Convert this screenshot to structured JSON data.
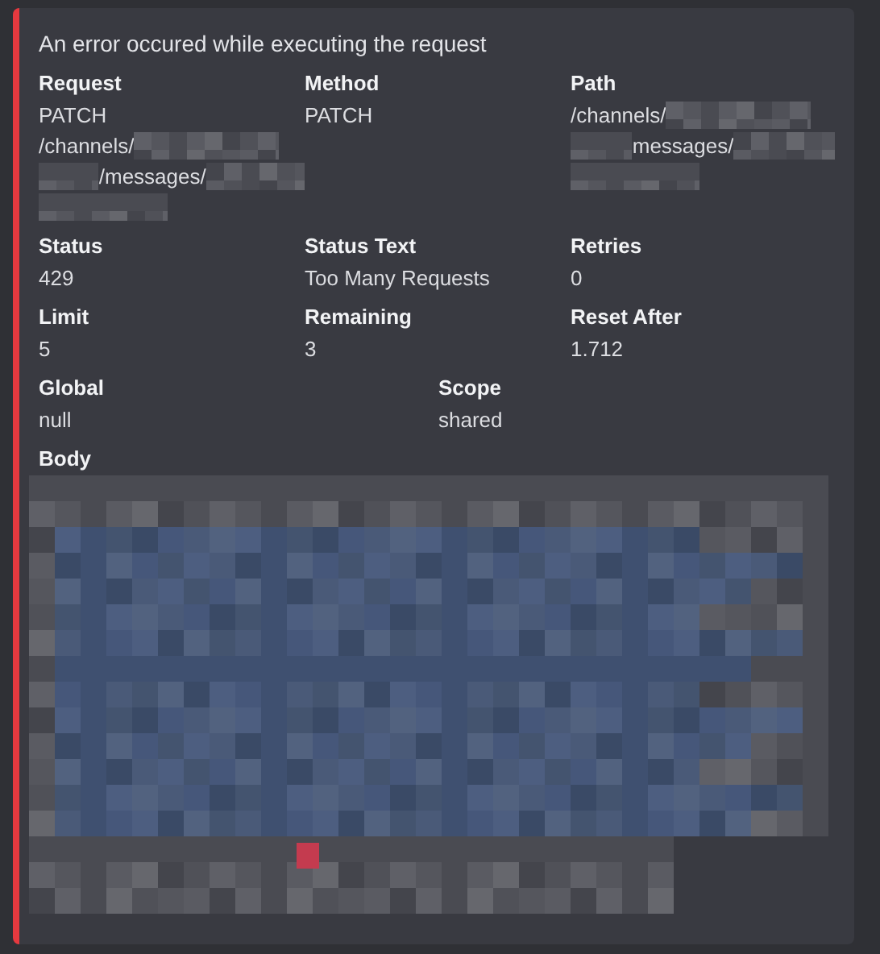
{
  "embed": {
    "title": "An error occured while executing the request",
    "rows": [
      {
        "fields": [
          {
            "name": "Request",
            "lines": [
              [
                {
                  "kind": "text",
                  "text": "PATCH"
                }
              ],
              [
                {
                  "kind": "text",
                  "text": "/channels/"
                },
                {
                  "kind": "redacted"
                }
              ],
              [
                {
                  "kind": "redacted"
                },
                {
                  "kind": "text",
                  "text": "/messages/"
                },
                {
                  "kind": "redacted"
                }
              ],
              [
                {
                  "kind": "redacted"
                }
              ]
            ]
          },
          {
            "name": "Method",
            "lines": [
              [
                {
                  "kind": "text",
                  "text": "PATCH"
                }
              ]
            ]
          },
          {
            "name": "Path",
            "lines": [
              [
                {
                  "kind": "text",
                  "text": "/channels/"
                },
                {
                  "kind": "redacted"
                }
              ],
              [
                {
                  "kind": "redacted"
                },
                {
                  "kind": "text",
                  "text": "messages/"
                },
                {
                  "kind": "redacted"
                }
              ],
              [
                {
                  "kind": "redacted"
                }
              ]
            ]
          }
        ]
      },
      {
        "fields": [
          {
            "name": "Status",
            "lines": [
              [
                {
                  "kind": "text",
                  "text": "429"
                }
              ]
            ]
          },
          {
            "name": "Status Text",
            "lines": [
              [
                {
                  "kind": "text",
                  "text": "Too Many Requests"
                }
              ]
            ]
          },
          {
            "name": "Retries",
            "lines": [
              [
                {
                  "kind": "text",
                  "text": "0"
                }
              ]
            ]
          }
        ]
      },
      {
        "fields": [
          {
            "name": "Limit",
            "lines": [
              [
                {
                  "kind": "text",
                  "text": "5"
                }
              ]
            ]
          },
          {
            "name": "Remaining",
            "lines": [
              [
                {
                  "kind": "text",
                  "text": "3"
                }
              ]
            ]
          },
          {
            "name": "Reset After",
            "lines": [
              [
                {
                  "kind": "text",
                  "text": "1.712"
                }
              ]
            ]
          }
        ]
      },
      {
        "fields": [
          {
            "name": "Global",
            "lines": [
              [
                {
                  "kind": "text",
                  "text": "null"
                }
              ]
            ]
          },
          {
            "name": "Scope",
            "lines": [
              [
                {
                  "kind": "text",
                  "text": "shared"
                }
              ]
            ]
          }
        ]
      },
      {
        "fields": [
          {
            "name": "Body",
            "lines": [
              [
                {
                  "kind": "redacted_block"
                }
              ]
            ]
          }
        ]
      }
    ]
  }
}
